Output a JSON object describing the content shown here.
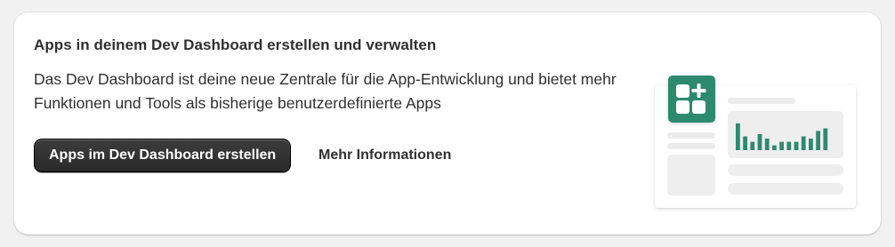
{
  "card": {
    "title": "Apps in deinem Dev Dashboard erstellen und verwalten",
    "description": "Das Dev Dashboard ist deine neue Zentrale für die App-Entwicklung und bietet mehr Funktionen und Tools als bisherige benutzerdefinierte Apps",
    "primary_button_label": "Apps im Dev Dashboard erstellen",
    "secondary_link_label": "Mehr Informationen"
  },
  "illustration": {
    "accent_color": "#2e8a6e",
    "icon": "app-grid-plus-icon",
    "bar_levels": [
      0.84,
      0.43,
      0.26,
      0.5,
      0.36,
      0.15,
      0.26,
      0.26,
      0.26,
      0.43,
      0.36,
      0.6,
      0.68
    ]
  }
}
